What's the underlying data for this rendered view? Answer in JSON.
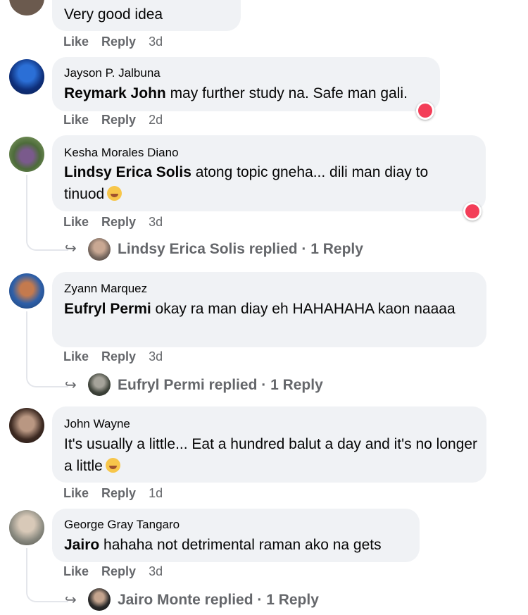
{
  "comments": [
    {
      "author": "",
      "text": "Very good idea",
      "like": "Like",
      "reply": "Reply",
      "time": "3d"
    },
    {
      "author": "Jayson P. Jalbuna",
      "mention": "Reymark John",
      "text": " may further study na. Safe man gali.",
      "like": "Like",
      "reply": "Reply",
      "time": "2d",
      "reaction": "heart"
    },
    {
      "author": "Kesha Morales Diano",
      "mention": "Lindsy Erica Solis",
      "text": " atong topic gneha... dili man diay to tinuod",
      "like": "Like",
      "reply": "Reply",
      "time": "3d",
      "reaction": "heart",
      "replies": "Lindsy Erica Solis replied · 1 Reply"
    },
    {
      "author": "Zyann Marquez",
      "mention": "Eufryl Permi",
      "text": " okay ra man diay eh HAHAHAHA kaon naaaa",
      "like": "Like",
      "reply": "Reply",
      "time": "3d",
      "replies": "Eufryl Permi replied · 1 Reply"
    },
    {
      "author": "John Wayne",
      "mention": "",
      "text": "It's usually a little... Eat a hundred balut a day and it's no longer a little",
      "like": "Like",
      "reply": "Reply",
      "time": "1d"
    },
    {
      "author": "George Gray Tangaro",
      "mention": "Jairo",
      "text": " hahaha not detrimental raman ako na gets",
      "like": "Like",
      "reply": "Reply",
      "time": "3d",
      "replies": "Jairo Monte replied · 1 Reply"
    }
  ],
  "colors": {
    "bubble": "#f0f2f5",
    "meta": "#65676b",
    "heart": "#f33e58"
  }
}
